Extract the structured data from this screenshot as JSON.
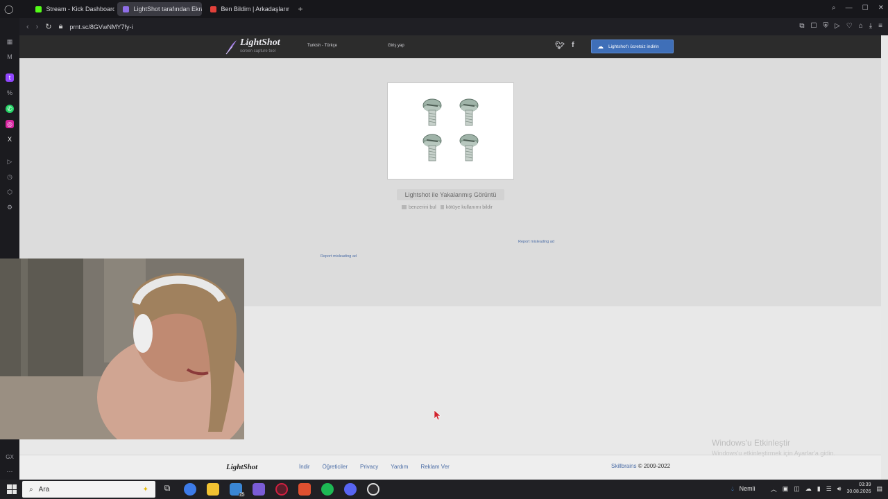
{
  "browser": {
    "tabs": [
      {
        "label": "Stream - Kick Dashboard",
        "color": "#53fc18"
      },
      {
        "label": "LightShot tarafından Ekran",
        "color": "#8f6ee8"
      },
      {
        "label": "Ben Bildim | Arkadaşlarınla",
        "color": "#e2403a"
      }
    ],
    "new_tab": "+",
    "url": "prnt.sc/8GVwNMY7fy-i"
  },
  "lightshot": {
    "logo_text": "LightShot",
    "logo_sub": "screen capture tool",
    "language": "Turkish - Türkçe",
    "login": "Giriş yap",
    "download_button": "Lightshot'ı ücretsiz indirin",
    "caption": "Lightshot ile Yakalanmış Görüntü",
    "action_similar": "benzerini bul",
    "action_report": "kötüye kullanımı bildir",
    "report_ad_1": "Report misleading ad",
    "report_ad_2": "Report misleading ad"
  },
  "footer": {
    "logo": "LightShot",
    "links": [
      "İndir",
      "Öğreticiler",
      "Privacy",
      "Yardım",
      "Reklam Ver"
    ],
    "brand": "Skillbrains",
    "copyright": "© 2009-2022"
  },
  "watermark": {
    "title": "Windows'u Etkinleştir",
    "subtitle": "Windows'u etkinleştirmek için Ayarlar'a gidin."
  },
  "taskbar": {
    "search_placeholder": "Ara",
    "weather": "Nemli",
    "time": "03:39",
    "date": "30.08.2026",
    "badge": "25"
  }
}
